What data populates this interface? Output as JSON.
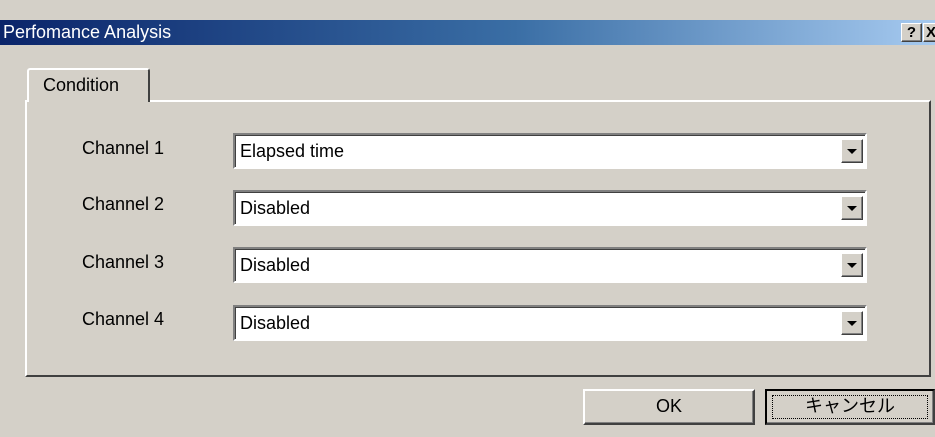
{
  "window": {
    "title": "Perfomance Analysis",
    "help_symbol": "?",
    "close_symbol": "X"
  },
  "tabs": [
    {
      "label": "Condition",
      "active": true
    }
  ],
  "channels": [
    {
      "label": "Channel 1",
      "value": "Elapsed time"
    },
    {
      "label": "Channel 2",
      "value": "Disabled"
    },
    {
      "label": "Channel 3",
      "value": "Disabled"
    },
    {
      "label": "Channel 4",
      "value": "Disabled"
    }
  ],
  "buttons": {
    "ok_label": "OK",
    "cancel_label": "キャンセル"
  },
  "colors": {
    "title_start": "#0a246a",
    "title_end": "#a6caf0",
    "face": "#d4d0c8"
  }
}
